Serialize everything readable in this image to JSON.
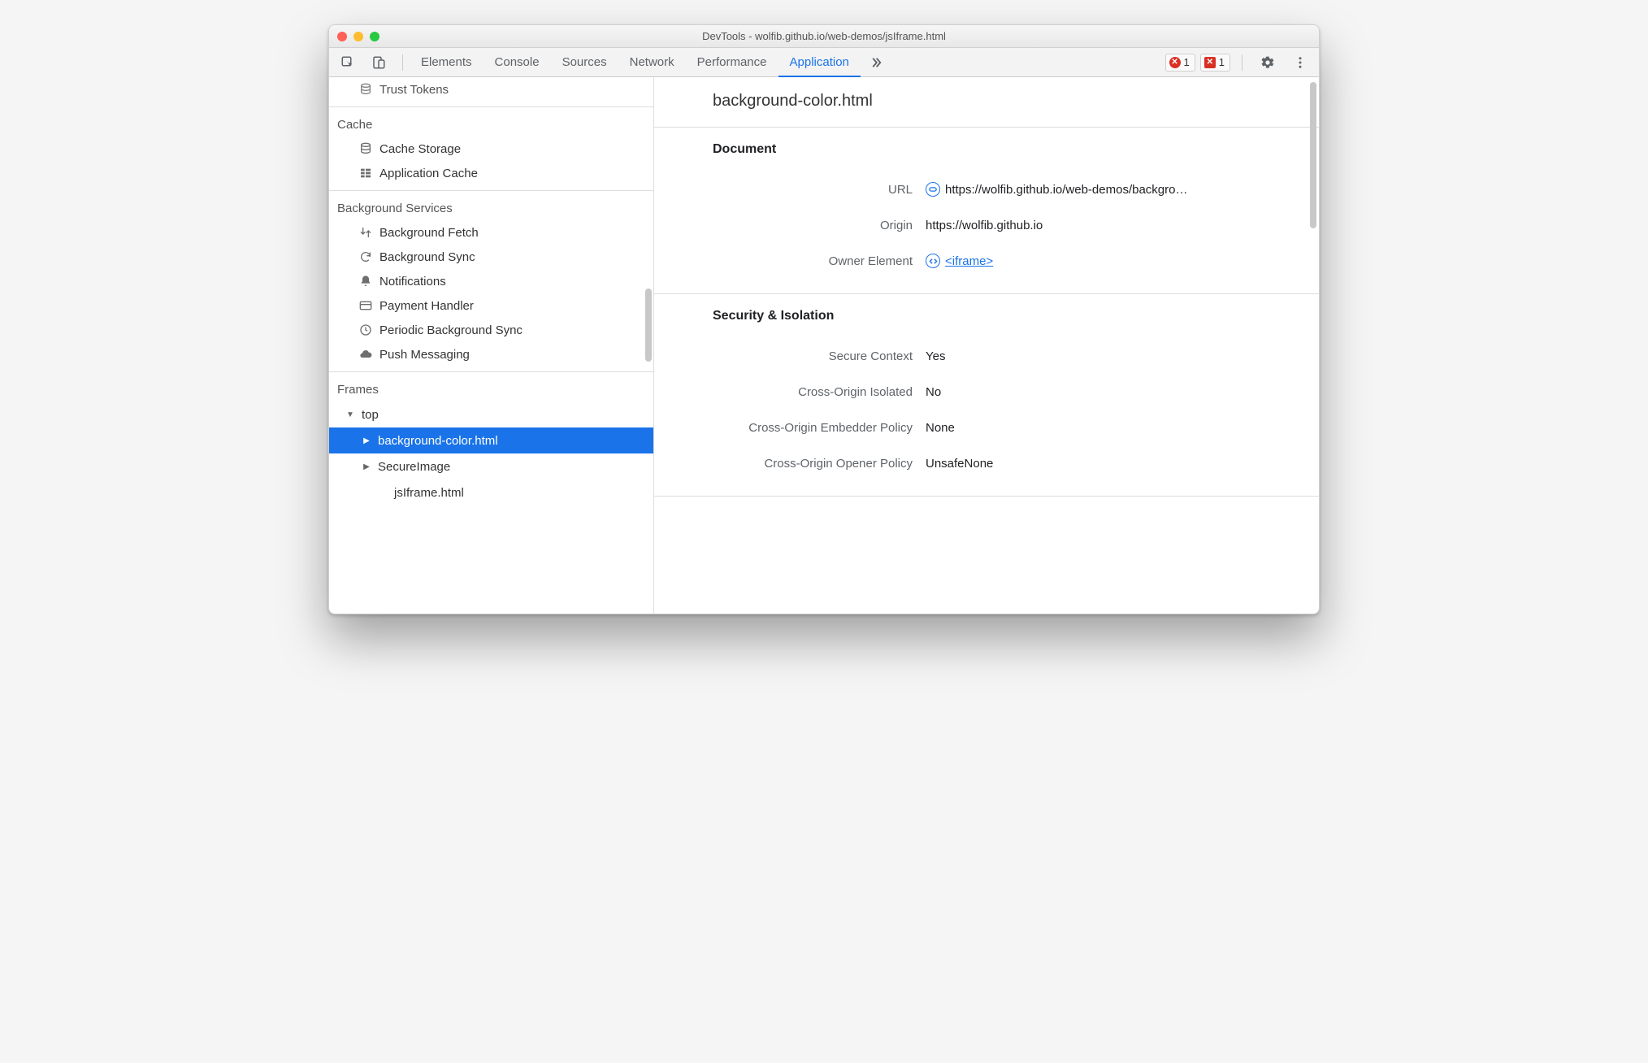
{
  "window": {
    "title": "DevTools - wolfib.github.io/web-demos/jsIframe.html"
  },
  "tabs": {
    "items": [
      "Elements",
      "Console",
      "Sources",
      "Network",
      "Performance",
      "Application"
    ],
    "active_index": 5,
    "error_count": "1",
    "blocked_count": "1"
  },
  "sidebar": {
    "trust_tokens": "Trust Tokens",
    "cache": {
      "header": "Cache",
      "items": [
        "Cache Storage",
        "Application Cache"
      ]
    },
    "background_services": {
      "header": "Background Services",
      "items": [
        "Background Fetch",
        "Background Sync",
        "Notifications",
        "Payment Handler",
        "Periodic Background Sync",
        "Push Messaging"
      ]
    },
    "frames": {
      "header": "Frames",
      "top": "top",
      "children": [
        {
          "label": "background-color.html",
          "selected": true
        },
        {
          "label": "SecureImage",
          "selected": false
        }
      ],
      "leaf": "jsIframe.html"
    }
  },
  "detail": {
    "title": "background-color.html",
    "sections": {
      "document": {
        "header": "Document",
        "url_label": "URL",
        "url_value": "https://wolfib.github.io/web-demos/backgro…",
        "origin_label": "Origin",
        "origin_value": "https://wolfib.github.io",
        "owner_label": "Owner Element",
        "owner_value": "<iframe>"
      },
      "security": {
        "header": "Security & Isolation",
        "rows": [
          {
            "label": "Secure Context",
            "value": "Yes"
          },
          {
            "label": "Cross-Origin Isolated",
            "value": "No"
          },
          {
            "label": "Cross-Origin Embedder Policy",
            "value": "None"
          },
          {
            "label": "Cross-Origin Opener Policy",
            "value": "UnsafeNone"
          }
        ]
      }
    }
  }
}
